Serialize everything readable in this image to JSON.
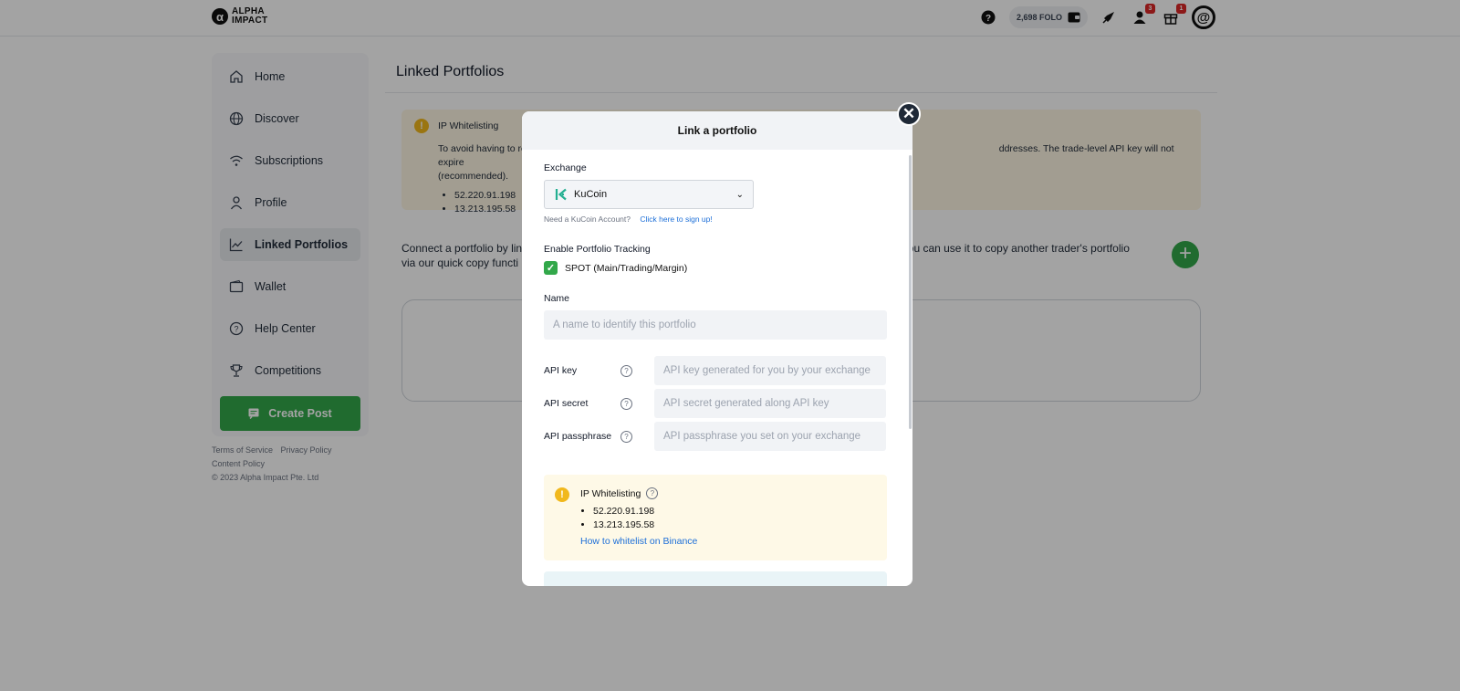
{
  "logo": {
    "mark": "α",
    "line1": "ALPHA",
    "line2": "IMPACT"
  },
  "topbar": {
    "folo_balance": "2,698 FOLO",
    "friends_badge": "3",
    "gift_badge": "1",
    "avatar_mark": "@"
  },
  "sidebar": {
    "items": [
      {
        "label": "Home",
        "icon": "home-icon"
      },
      {
        "label": "Discover",
        "icon": "globe-icon"
      },
      {
        "label": "Subscriptions",
        "icon": "wifi-icon"
      },
      {
        "label": "Profile",
        "icon": "user-icon"
      },
      {
        "label": "Linked Portfolios",
        "icon": "chart-icon",
        "active": true
      },
      {
        "label": "Wallet",
        "icon": "wallet-icon"
      },
      {
        "label": "Help Center",
        "icon": "help-icon"
      },
      {
        "label": "Competitions",
        "icon": "trophy-icon"
      }
    ],
    "create_post": "Create Post"
  },
  "footer": {
    "terms": "Terms of Service",
    "privacy": "Privacy Policy",
    "content": "Content Policy",
    "copyright": "© 2023 Alpha Impact Pte. Ltd"
  },
  "main": {
    "title": "Linked Portfolios",
    "warning": {
      "title": "IP Whitelisting",
      "text_start": "To avoid having to re",
      "text_end": "ddresses. The trade-level API key will not expire",
      "text_line2": "(recommended).",
      "ips": [
        "52.220.91.198",
        "13.213.195.58"
      ]
    },
    "connect_line1_start": "Connect a portfolio by lin",
    "connect_line1_end": "you can use it to copy another trader's portfolio",
    "connect_line2": "via our quick copy functi"
  },
  "modal": {
    "title": "Link a portfolio",
    "exchange_label": "Exchange",
    "exchange_value": "KuCoin",
    "need_account": "Need a KuCoin Account?",
    "signup_link": "Click here to sign up!",
    "tracking_label": "Enable Portfolio Tracking",
    "spot_label": "SPOT (Main/Trading/Margin)",
    "spot_checked": true,
    "name_label": "Name",
    "name_placeholder": "A name to identify this portfolio",
    "api_key_label": "API key",
    "api_key_placeholder": "API key generated for you by your exchange",
    "api_secret_label": "API secret",
    "api_secret_placeholder": "API secret generated along API key",
    "api_pass_label": "API passphrase",
    "api_pass_placeholder": "API passphrase you set on your exchange",
    "ip_title": "IP Whitelisting",
    "ips": [
      "52.220.91.198",
      "13.213.195.58"
    ],
    "ip_link": "How to whitelist on Binance"
  },
  "colors": {
    "accent_green": "#32a84a",
    "warning_yellow": "#f1b81c",
    "link_blue": "#1d6fd8"
  }
}
